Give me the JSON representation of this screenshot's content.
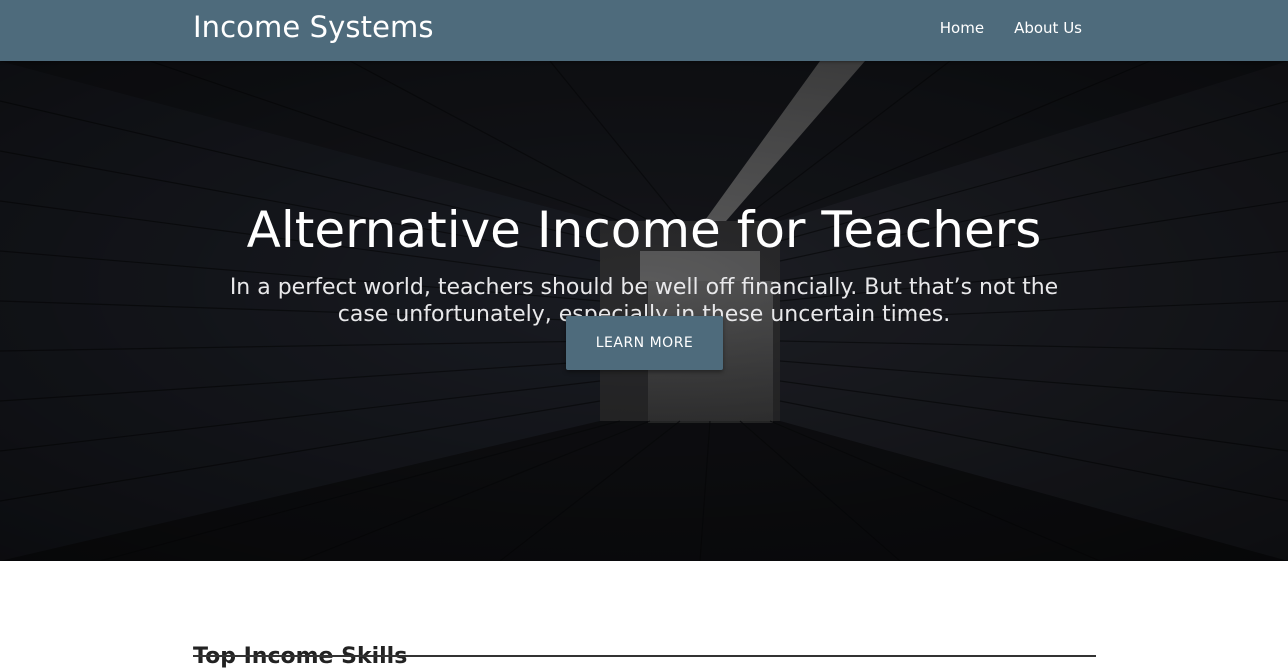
{
  "navbar": {
    "brand": "Income Systems",
    "links": [
      "Home",
      "About Us"
    ]
  },
  "hero": {
    "title": "Alternative Income for Teachers",
    "subtitle": "In a perfect world, teachers should be well off financially. But that’s not the case unfortunately, especially in these uncertain times.",
    "cta_label": "LEARN MORE"
  },
  "section": {
    "title": "Top Income Skills"
  },
  "colors": {
    "navbar_bg": "#4e6b7c",
    "button_bg": "#4e6b7c",
    "hero_overlay": "#17181d"
  }
}
